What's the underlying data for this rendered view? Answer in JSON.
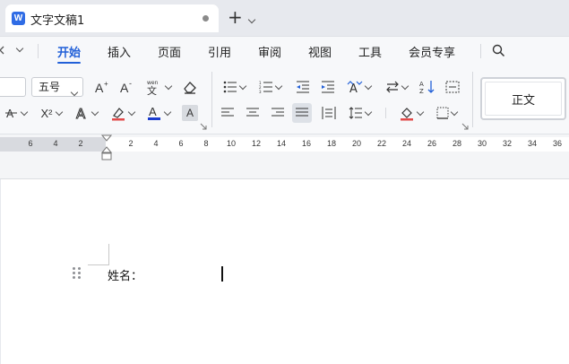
{
  "titlebar": {
    "app_logo": "W",
    "doc_title": "文字文稿1"
  },
  "menu": {
    "items": [
      "开始",
      "插入",
      "页面",
      "引用",
      "审阅",
      "视图",
      "工具",
      "会员专享"
    ],
    "active": "开始"
  },
  "ribbon": {
    "font_size": "五号",
    "style_name": "正文",
    "superscript_label": "X²",
    "font_color": "#1a3ccf",
    "highlight_color": "#e24a4a"
  },
  "ruler": {
    "left_numbers": [
      "6",
      "4",
      "2"
    ],
    "right_numbers": [
      "2",
      "4",
      "6",
      "8",
      "10",
      "12",
      "14",
      "16",
      "18",
      "20",
      "22",
      "24",
      "26",
      "28",
      "30",
      "32",
      "34",
      "36"
    ]
  },
  "document": {
    "paragraph": "姓名："
  },
  "colors": {
    "accent": "#2260d8",
    "page": "#ffffff"
  }
}
